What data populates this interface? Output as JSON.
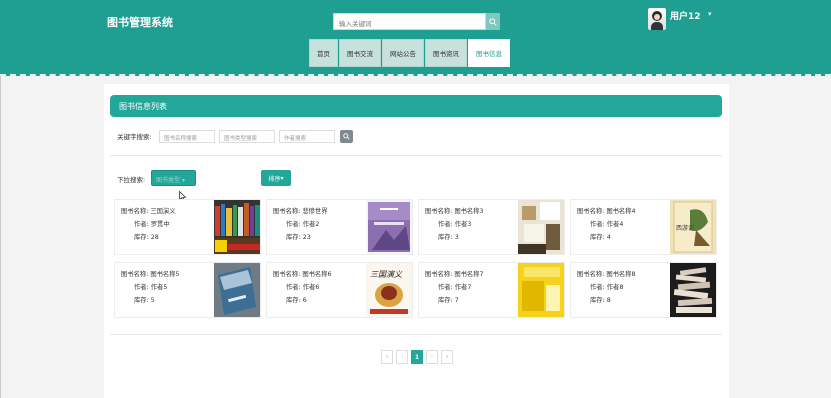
{
  "header": {
    "site_title": "图书管理系统",
    "search_placeholder": "输入关键词",
    "user_name": "用户12"
  },
  "nav": [
    {
      "label": "首页",
      "active": false
    },
    {
      "label": "图书交流",
      "active": false
    },
    {
      "label": "网站公告",
      "active": false
    },
    {
      "label": "图书资讯",
      "active": false
    },
    {
      "label": "图书信息",
      "active": true
    }
  ],
  "panel": {
    "title": "图书信息列表",
    "keyword_label": "关键字搜索:",
    "keyword_inputs": [
      "图书名称搜索",
      "图书类型搜索",
      "作者搜索"
    ],
    "dropdown_label": "下拉搜索:",
    "dropdown_value": "图书类型",
    "sort_label": "排序"
  },
  "book_field_labels": {
    "name": "图书名称:",
    "author": "作者:",
    "stock": "库存:"
  },
  "books": [
    {
      "name": "三国演义",
      "author": "罗贯中",
      "stock": "28",
      "cover": "shelf"
    },
    {
      "name": "悲惨世界",
      "author": "作者2",
      "stock": "23",
      "cover": "purple"
    },
    {
      "name": "图书名称3",
      "author": "作者3",
      "stock": "3",
      "cover": "cubes"
    },
    {
      "name": "图书名称4",
      "author": "作者4",
      "stock": "4",
      "cover": "xiyouji"
    },
    {
      "name": "图书名称5",
      "author": "作者5",
      "stock": "5",
      "cover": "blue"
    },
    {
      "name": "图书名称6",
      "author": "作者6",
      "stock": "6",
      "cover": "sanguo"
    },
    {
      "name": "图书名称7",
      "author": "作者7",
      "stock": "7",
      "cover": "yellow"
    },
    {
      "name": "图书名称8",
      "author": "作者8",
      "stock": "8",
      "cover": "stack"
    }
  ],
  "pagination": {
    "first": "«",
    "prev": "‹",
    "current": "1",
    "next": "›",
    "last": "»"
  },
  "colors": {
    "accent": "#1f9f91",
    "nav_bg": "#c7e2dc"
  }
}
